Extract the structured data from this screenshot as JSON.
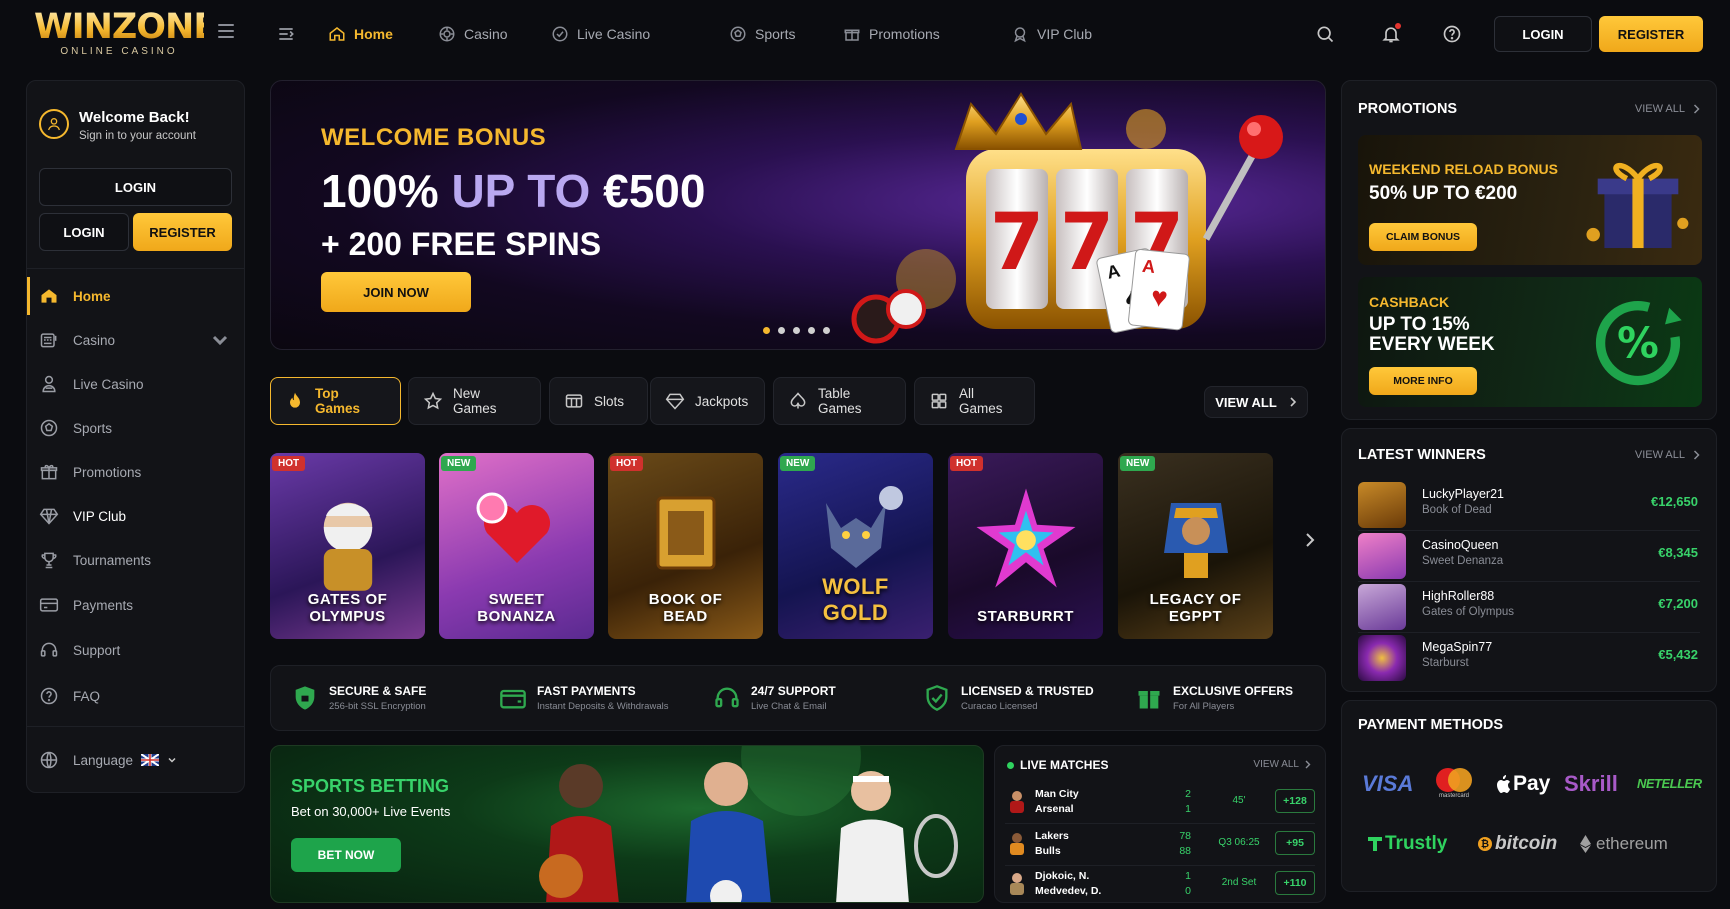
{
  "brand": {
    "name": "WINZONE",
    "tagline": "ONLINE CASINO"
  },
  "topnav": {
    "items": [
      {
        "label": "Home",
        "icon": "home-icon",
        "active": true
      },
      {
        "label": "Casino",
        "icon": "casino-chip-icon"
      },
      {
        "label": "Live Casino",
        "icon": "live-casino-icon"
      },
      {
        "label": "Sports",
        "icon": "soccer-ball-icon"
      },
      {
        "label": "Promotions",
        "icon": "gift-icon"
      },
      {
        "label": "VIP Club",
        "icon": "vip-badge-icon"
      }
    ],
    "login": "LOGIN",
    "register": "REGISTER"
  },
  "sidebar": {
    "welcome_title": "Welcome Back!",
    "welcome_sub": "Sign in to your account",
    "login_full": "LOGIN",
    "login": "LOGIN",
    "register": "REGISTER",
    "items": [
      {
        "label": "Home",
        "icon": "home-icon",
        "active": true
      },
      {
        "label": "Casino",
        "icon": "slot-machine-icon",
        "expandable": true
      },
      {
        "label": "Live Casino",
        "icon": "dealer-icon"
      },
      {
        "label": "Sports",
        "icon": "soccer-ball-icon"
      },
      {
        "label": "Promotions",
        "icon": "gift-icon"
      },
      {
        "label": "VIP Club",
        "icon": "diamond-icon"
      },
      {
        "label": "Tournaments",
        "icon": "trophy-icon"
      },
      {
        "label": "Payments",
        "icon": "credit-card-icon"
      },
      {
        "label": "Support",
        "icon": "headset-icon"
      },
      {
        "label": "FAQ",
        "icon": "question-icon"
      }
    ],
    "language": "Language"
  },
  "hero": {
    "kicker": "WELCOME BONUS",
    "main_a": "100% ",
    "main_b": "UP TO",
    "main_c": " €500",
    "sub": "+ 200 FREE SPINS",
    "cta": "JOIN NOW"
  },
  "categories": {
    "tabs": [
      {
        "label": "Top Games",
        "icon": "flame-icon",
        "active": true
      },
      {
        "label": "New Games",
        "icon": "star-icon"
      },
      {
        "label": "Slots",
        "icon": "slots-icon"
      },
      {
        "label": "Jackpots",
        "icon": "diamond-icon"
      },
      {
        "label": "Table Games",
        "icon": "spade-icon"
      },
      {
        "label": "All Games",
        "icon": "grid-icon"
      }
    ],
    "view_all": "VIEW ALL"
  },
  "games": [
    {
      "title": "GATES OF OLYMPUS",
      "badge": "HOT"
    },
    {
      "title": "SWEET BONANZA",
      "badge": "NEW"
    },
    {
      "title": "BOOK OF BEAD",
      "badge": "HOT"
    },
    {
      "title": "WOLF GOLD",
      "badge": "NEW"
    },
    {
      "title": "STARBURRT",
      "badge": "HOT"
    },
    {
      "title": "LEGACY OF EGPPT",
      "badge": "NEW"
    }
  ],
  "features": [
    {
      "title": "SECURE & SAFE",
      "sub": "256-bit SSL Encryption",
      "icon": "shield-icon"
    },
    {
      "title": "FAST PAYMENTS",
      "sub": "Instant Deposits & Withdrawals",
      "icon": "wallet-icon"
    },
    {
      "title": "24/7 SUPPORT",
      "sub": "Live Chat & Email",
      "icon": "headset-icon"
    },
    {
      "title": "LICENSED & TRUSTED",
      "sub": "Curacao Licensed",
      "icon": "shield-check-icon"
    },
    {
      "title": "EXCLUSIVE OFFERS",
      "sub": "For All Players",
      "icon": "gift-icon"
    }
  ],
  "sports": {
    "title": "SPORTS BETTING",
    "sub": "Bet on 30,000+ Live Events",
    "cta": "BET NOW"
  },
  "live": {
    "title": "LIVE MATCHES",
    "view_all": "VIEW ALL",
    "matches": [
      {
        "team1": "Man City",
        "team2": "Arsenal",
        "s1": "2",
        "s2": "1",
        "time": "45'",
        "odds": "+128",
        "icon": "soccer-jersey-icon"
      },
      {
        "team1": "Lakers",
        "team2": "Bulls",
        "s1": "78",
        "s2": "88",
        "time": "Q3 06:25",
        "odds": "+95",
        "icon": "basketball-jersey-icon"
      },
      {
        "team1": "Djokoic, N.",
        "team2": "Medvedev, D.",
        "s1": "1",
        "s2": "0",
        "time": "2nd Set",
        "odds": "+110",
        "icon": "tennis-player-icon"
      }
    ]
  },
  "promotions": {
    "title": "PROMOTIONS",
    "view_all": "VIEW ALL",
    "cards": [
      {
        "kicker": "WEEKEND RELOAD BONUS",
        "main": "50% UP TO €200",
        "cta": "CLAIM BONUS"
      },
      {
        "kicker": "CASHBACK",
        "main1": "UP TO 15%",
        "main2": "EVERY WEEK",
        "cta": "MORE INFO"
      }
    ]
  },
  "winners": {
    "title": "LATEST WINNERS",
    "view_all": "VIEW ALL",
    "rows": [
      {
        "name": "LuckyPlayer21",
        "game": "Book of Dead",
        "amount": "€12,650"
      },
      {
        "name": "CasinoQueen",
        "game": "Sweet Denanza",
        "amount": "€8,345"
      },
      {
        "name": "HighRoller88",
        "game": "Gates of Olympus",
        "amount": "€7,200"
      },
      {
        "name": "MegaSpin77",
        "game": "Starburst",
        "amount": "€5,432"
      }
    ]
  },
  "payments": {
    "title": "PAYMENT METHODS",
    "methods": [
      "VISA",
      "mastercard",
      "Pay",
      "Skrill",
      "NETELLER",
      "Trustly",
      "bitcoin",
      "ethereum"
    ]
  }
}
